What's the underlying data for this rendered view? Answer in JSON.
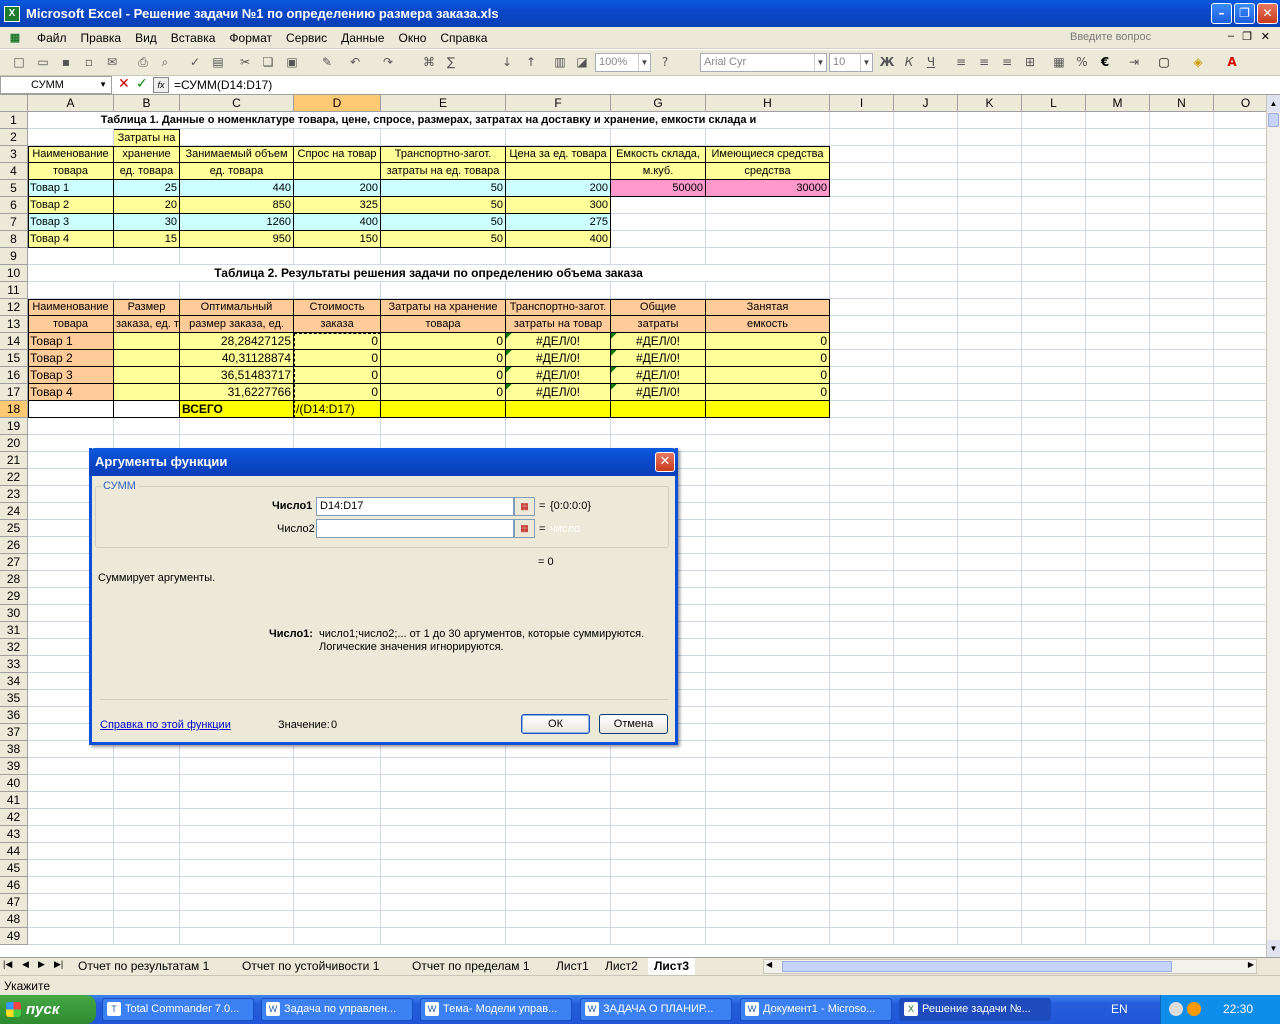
{
  "window": {
    "title": "Microsoft Excel - Решение задачи №1 по определению размера заказа.xls"
  },
  "menu": [
    {
      "label": "Файл"
    },
    {
      "label": "Правка"
    },
    {
      "label": "Вид"
    },
    {
      "label": "Вставка"
    },
    {
      "label": "Формат"
    },
    {
      "label": "Сервис"
    },
    {
      "label": "Данные"
    },
    {
      "label": "Окно"
    },
    {
      "label": "Справка"
    }
  ],
  "ask_placeholder": "Введите вопрос",
  "toolbar": {
    "zoom": "100%",
    "font": "Arial Cyr",
    "size": "10"
  },
  "formula_bar": {
    "name_box": "СУММ",
    "formula": "=СУММ(D14:D17)"
  },
  "columns": [
    "A",
    "B",
    "C",
    "D",
    "E",
    "F",
    "G",
    "H",
    "I",
    "J",
    "K",
    "L",
    "M",
    "N",
    "O"
  ],
  "cells": {
    "A1": "Таблица 1. Данные о номенклатуре товара, цене, спросе, размерах, затратах на доставку и хранение, емкости склада и",
    "A3": "Наименование",
    "A4": "товара",
    "B2h": "Затраты на",
    "B3": "хранение",
    "B4": "ед. товара",
    "C3": "Занимаемый объем",
    "C4": "ед. товара",
    "D3": "Спрос на товар",
    "E3": "Транспортно-загот.",
    "E4": "затраты на ед. товара",
    "F3": "Цена за ед. товара",
    "G3": "Емкость склада,",
    "G4": "м.куб.",
    "H3": "Имеющиеся средства",
    "H4": "средства",
    "A5": "Товар 1",
    "B5": "25",
    "C5": "440",
    "D5": "200",
    "E5": "50",
    "F5": "200",
    "G5": "50000",
    "H5": "30000",
    "A6": "Товар 2",
    "B6": "20",
    "C6": "850",
    "D6": "325",
    "E6": "50",
    "F6": "300",
    "A7": "Товар 3",
    "B7": "30",
    "C7": "1260",
    "D7": "400",
    "E7": "50",
    "F7": "275",
    "A8": "Товар 4",
    "B8": "15",
    "C8": "950",
    "D8": "150",
    "E8": "50",
    "F8": "400",
    "A10": "Таблица 2. Результаты решения задачи по определению объема заказа",
    "A12": "Наименование",
    "A13": "товара",
    "B12": "Размер",
    "B13": "заказа, ед. товара",
    "C12": "Оптимальный",
    "C13": "размер заказа, ед.",
    "D12": "Стоимость",
    "D13": "заказа",
    "E12": "Затраты на хранение",
    "E13": "товара",
    "F12": "Транспортно-загот.",
    "F13": "затраты на товар",
    "G12": "Общие",
    "G13": "затраты",
    "H12": "Занятая",
    "H13": "емкость",
    "A14": "Товар 1",
    "C14": "28,28427125",
    "D14": "0",
    "E14": "0",
    "F14": "#ДЕЛ/0!",
    "G14": "#ДЕЛ/0!",
    "H14": "0",
    "A15": "Товар 2",
    "C15": "40,31128874",
    "D15": "0",
    "E15": "0",
    "F15": "#ДЕЛ/0!",
    "G15": "#ДЕЛ/0!",
    "H15": "0",
    "A16": "Товар 3",
    "C16": "36,51483717",
    "D16": "0",
    "E16": "0",
    "F16": "#ДЕЛ/0!",
    "G16": "#ДЕЛ/0!",
    "H16": "0",
    "A17": "Товар 4",
    "C17": "31,6227766",
    "D17": "0",
    "E17": "0",
    "F17": "#ДЕЛ/0!",
    "G17": "#ДЕЛ/0!",
    "H17": "0",
    "C18": "ВСЕГО",
    "D18": "/(D14:D17)"
  },
  "dialog": {
    "title": "Аргументы функции",
    "func_name": "СУММ",
    "arg1_label": "Число1",
    "arg1_value": "D14:D17",
    "arg1_result": "{0:0:0:0}",
    "arg2_label": "Число2",
    "arg2_result": "число",
    "eq": "=",
    "total": "= 0",
    "description": "Суммирует аргументы.",
    "help_label": "Число1:",
    "help_text1": "число1;число2;... от 1 до 30 аргументов, которые суммируются.",
    "help_text2": "Логические значения игнорируются.",
    "help_link": "Справка по этой функции",
    "value_label": "Значение:",
    "value": "0",
    "ok": "ОК",
    "cancel": "Отмена"
  },
  "sheets": [
    {
      "label": "Отчет по результатам 1"
    },
    {
      "label": "Отчет по устойчивости 1"
    },
    {
      "label": "Отчет по пределам 1"
    },
    {
      "label": "Лист1"
    },
    {
      "label": "Лист2"
    },
    {
      "label": "Лист3",
      "active": true
    }
  ],
  "status": "Укажите",
  "taskbar": {
    "start": "пуск",
    "tasks": [
      {
        "label": "Total Commander 7.0..."
      },
      {
        "label": "Задача по управлен..."
      },
      {
        "label": "Тема- Модели управ..."
      },
      {
        "label": "ЗАДАЧА О ПЛАНИР..."
      },
      {
        "label": "Документ1 - Microso..."
      },
      {
        "label": "Решение задачи №...",
        "active": true
      }
    ],
    "lang": "EN",
    "clock": "22:30"
  },
  "colors": {
    "cyan": "#ccffff",
    "yellow": "#ffff99",
    "pink": "#ff99cc",
    "orange": "#ffcc99",
    "gold": "#ffff00"
  }
}
